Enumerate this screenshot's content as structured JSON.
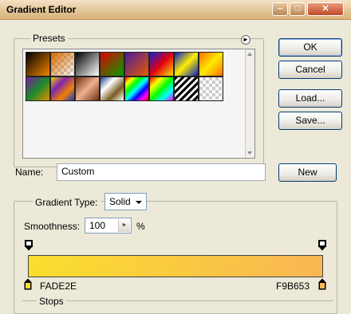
{
  "window": {
    "title": "Gradient Editor",
    "controls": [
      "minimize",
      "maximize",
      "close"
    ]
  },
  "presets": {
    "label": "Presets",
    "menu_icon": "circle-arrow-right-icon",
    "swatches": [
      {
        "name": "foreground-to-background",
        "colors": [
          "#000000",
          "#f08400"
        ]
      },
      {
        "name": "foreground-to-transparent",
        "colors": [
          "#d46b00",
          "#ffffff00"
        ]
      },
      {
        "name": "black-white",
        "colors": [
          "#000000",
          "#ffffff"
        ]
      },
      {
        "name": "red-green",
        "colors": [
          "#e00000",
          "#00a000"
        ]
      },
      {
        "name": "violet-orange",
        "colors": [
          "#4b1a9c",
          "#e65c00"
        ]
      },
      {
        "name": "blue-red-yellow",
        "colors": [
          "#1520d0",
          "#e00010",
          "#ffe000"
        ]
      },
      {
        "name": "blue-yellow-blue",
        "colors": [
          "#0a1cc8",
          "#ffee00",
          "#0a1cc8"
        ]
      },
      {
        "name": "orange-yellow-orange",
        "colors": [
          "#ff7000",
          "#ffea00",
          "#ff7000"
        ]
      },
      {
        "name": "violet-green-orange",
        "colors": [
          "#7a1ba0",
          "#1a8c2c",
          "#e88a00"
        ]
      },
      {
        "name": "yellow-violet-orange-blue",
        "colors": [
          "#f0d000",
          "#8024b0",
          "#f08000",
          "#1c3cc8"
        ]
      },
      {
        "name": "copper",
        "colors": [
          "#6b2f10",
          "#f0b090",
          "#6b2f10"
        ]
      },
      {
        "name": "chrome",
        "colors": [
          "#1a3a90",
          "#ffffff",
          "#7a5a20",
          "#ffffff"
        ]
      },
      {
        "name": "spectrum",
        "colors": [
          "#ff0000",
          "#ffff00",
          "#00ff00",
          "#00ffff",
          "#0000ff",
          "#ff00ff",
          "#ff0000"
        ]
      },
      {
        "name": "transparent-rainbow",
        "colors": [
          "#ff0000",
          "#ffff00",
          "#00ff00",
          "#00ffff",
          "#ff00ff"
        ]
      },
      {
        "name": "transparent-stripes",
        "colors": [
          "#000000",
          "#ffffff"
        ]
      },
      {
        "name": "checker-transparent",
        "colors": [
          "#ffffff",
          "#cccccc"
        ]
      }
    ]
  },
  "buttons": {
    "ok": "OK",
    "cancel": "Cancel",
    "load": "Load...",
    "save": "Save...",
    "new": "New"
  },
  "name_field": {
    "label": "Name:",
    "value": "Custom"
  },
  "gradient_type": {
    "label": "Gradient Type:",
    "value": "Solid"
  },
  "smoothness": {
    "label": "Smoothness:",
    "value": "100",
    "unit": "%"
  },
  "gradient": {
    "start_color": "#FADE2E",
    "end_color": "#F9B653",
    "start_label": "FADE2E",
    "end_label": "F9B653"
  },
  "stops_group": {
    "label": "Stops"
  }
}
